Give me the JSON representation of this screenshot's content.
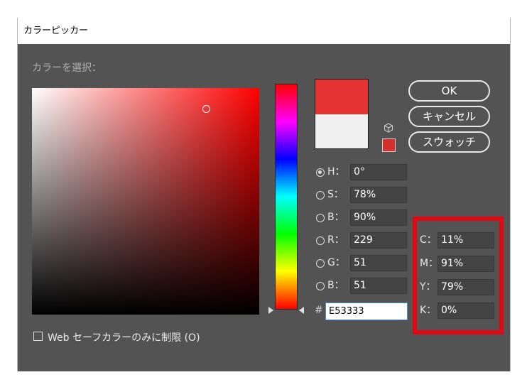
{
  "window": {
    "title": "カラーピッカー"
  },
  "picker": {
    "select_label": "カラーを選択："
  },
  "colors": {
    "current": "#e53333",
    "previous": "#f0f0f0",
    "websafe": "#d3302c",
    "cmyk_highlight": "#e30613",
    "background": "#535353"
  },
  "buttons": {
    "ok": "OK",
    "cancel": "キャンセル",
    "swatch": "スウォッチ"
  },
  "hsb_rgb": [
    {
      "key": "H",
      "label": "H：",
      "value": "0°",
      "checked": true
    },
    {
      "key": "S",
      "label": "S：",
      "value": "78%",
      "checked": false
    },
    {
      "key": "B",
      "label": "B：",
      "value": "90%",
      "checked": false
    },
    {
      "key": "R",
      "label": "R：",
      "value": "229",
      "checked": false
    },
    {
      "key": "G",
      "label": "G：",
      "value": "51",
      "checked": false
    },
    {
      "key": "B2",
      "label": "B：",
      "value": "51",
      "checked": false
    }
  ],
  "cmyk": [
    {
      "key": "C",
      "label": "C：",
      "value": "11%"
    },
    {
      "key": "M",
      "label": "M：",
      "value": "91%"
    },
    {
      "key": "Y",
      "label": "Y：",
      "value": "79%"
    },
    {
      "key": "K",
      "label": "K：",
      "value": "0%"
    }
  ],
  "hex": {
    "prefix": "#",
    "value": "E53333"
  },
  "web_safe": {
    "label": "Web セーフカラーのみに制限 (O)",
    "checked": false
  },
  "icons": {
    "gamut_warning": "cube-icon",
    "websafe_indicator": "swatch"
  }
}
